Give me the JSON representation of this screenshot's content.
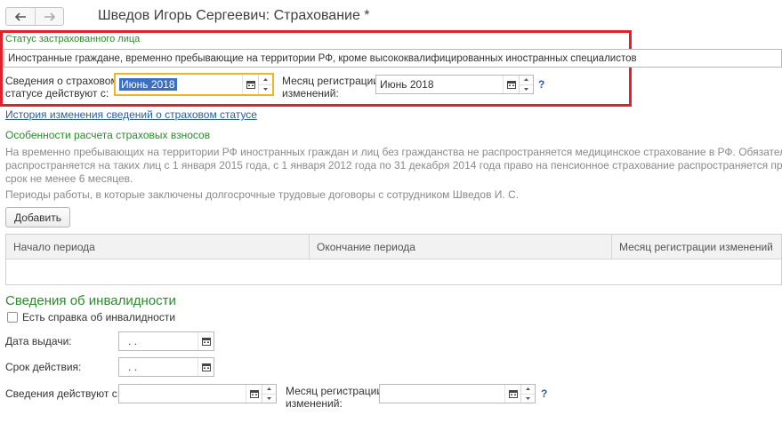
{
  "window": {
    "title": "Шведов Игорь Сергеевич: Страхование *",
    "back_icon": "arrow-left-icon",
    "forward_icon": "arrow-right-icon"
  },
  "insured_status": {
    "label": "Статус застрахованного лица",
    "value": "Иностранные граждане, временно пребывающие на территории РФ, кроме высококвалифицированных иностранных специалистов"
  },
  "status_info": {
    "label_line1": "Сведения о страховом",
    "label_line2": "статусе действуют с:",
    "value": "Июнь 2018",
    "reg_label_line1": "Месяц регистрации",
    "reg_label_line2": "изменений:",
    "reg_value": "Июнь 2018",
    "help": "?"
  },
  "history_link": "История изменения сведений о страховом статусе",
  "calc_section": {
    "title": "Особенности расчета страховых взносов",
    "line1": "На временно пребывающих на территории РФ иностранных граждан и лиц без гражданства не распространяется медицинское страхование в РФ. Обязательное соц",
    "line2": "распространяется на таких лиц с 1 января 2015 года, с 1 января 2012 года по 31 декабря 2014 года право на пенсионное страхование распространяется при услови",
    "line3": "срок не менее 6 месяцев.",
    "periods_text": "Периоды работы, в которые заключены долгосрочные трудовые договоры с сотрудником Шведов И. С.",
    "add_button": "Добавить",
    "columns": [
      "Начало периода",
      "Окончание периода",
      "Месяц регистрации изменений"
    ],
    "rows": []
  },
  "disability": {
    "title": "Сведения об инвалидности",
    "has_certificate_label": "Есть справка об инвалидности",
    "has_certificate": false,
    "issue_date_label": "Дата выдачи:",
    "issue_date_value": " .  .",
    "validity_label": "Срок действия:",
    "validity_value": " .  .",
    "effective_from_label": "Сведения действуют с:",
    "effective_from_value": "",
    "reg_label_line1": "Месяц регистрации",
    "reg_label_line2": "изменений:",
    "reg_value": "",
    "help": "?"
  },
  "colors": {
    "highlight_border": "#e0202d",
    "section_green": "#2d8a2d",
    "link_blue": "#2b5ba8",
    "focus_border": "#f0b429",
    "selection_bg": "#3a6fc4"
  }
}
